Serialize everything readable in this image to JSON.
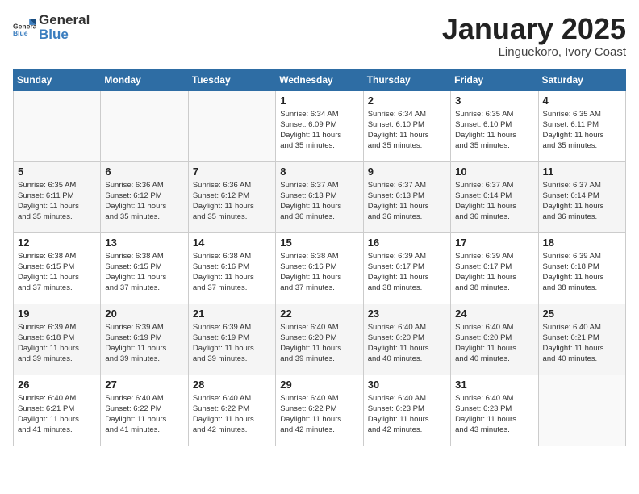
{
  "header": {
    "logo_general": "General",
    "logo_blue": "Blue",
    "month": "January 2025",
    "location": "Linguekoro, Ivory Coast"
  },
  "days_of_week": [
    "Sunday",
    "Monday",
    "Tuesday",
    "Wednesday",
    "Thursday",
    "Friday",
    "Saturday"
  ],
  "weeks": [
    [
      {
        "day": "",
        "info": ""
      },
      {
        "day": "",
        "info": ""
      },
      {
        "day": "",
        "info": ""
      },
      {
        "day": "1",
        "info": "Sunrise: 6:34 AM\nSunset: 6:09 PM\nDaylight: 11 hours\nand 35 minutes."
      },
      {
        "day": "2",
        "info": "Sunrise: 6:34 AM\nSunset: 6:10 PM\nDaylight: 11 hours\nand 35 minutes."
      },
      {
        "day": "3",
        "info": "Sunrise: 6:35 AM\nSunset: 6:10 PM\nDaylight: 11 hours\nand 35 minutes."
      },
      {
        "day": "4",
        "info": "Sunrise: 6:35 AM\nSunset: 6:11 PM\nDaylight: 11 hours\nand 35 minutes."
      }
    ],
    [
      {
        "day": "5",
        "info": "Sunrise: 6:35 AM\nSunset: 6:11 PM\nDaylight: 11 hours\nand 35 minutes."
      },
      {
        "day": "6",
        "info": "Sunrise: 6:36 AM\nSunset: 6:12 PM\nDaylight: 11 hours\nand 35 minutes."
      },
      {
        "day": "7",
        "info": "Sunrise: 6:36 AM\nSunset: 6:12 PM\nDaylight: 11 hours\nand 35 minutes."
      },
      {
        "day": "8",
        "info": "Sunrise: 6:37 AM\nSunset: 6:13 PM\nDaylight: 11 hours\nand 36 minutes."
      },
      {
        "day": "9",
        "info": "Sunrise: 6:37 AM\nSunset: 6:13 PM\nDaylight: 11 hours\nand 36 minutes."
      },
      {
        "day": "10",
        "info": "Sunrise: 6:37 AM\nSunset: 6:14 PM\nDaylight: 11 hours\nand 36 minutes."
      },
      {
        "day": "11",
        "info": "Sunrise: 6:37 AM\nSunset: 6:14 PM\nDaylight: 11 hours\nand 36 minutes."
      }
    ],
    [
      {
        "day": "12",
        "info": "Sunrise: 6:38 AM\nSunset: 6:15 PM\nDaylight: 11 hours\nand 37 minutes."
      },
      {
        "day": "13",
        "info": "Sunrise: 6:38 AM\nSunset: 6:15 PM\nDaylight: 11 hours\nand 37 minutes."
      },
      {
        "day": "14",
        "info": "Sunrise: 6:38 AM\nSunset: 6:16 PM\nDaylight: 11 hours\nand 37 minutes."
      },
      {
        "day": "15",
        "info": "Sunrise: 6:38 AM\nSunset: 6:16 PM\nDaylight: 11 hours\nand 37 minutes."
      },
      {
        "day": "16",
        "info": "Sunrise: 6:39 AM\nSunset: 6:17 PM\nDaylight: 11 hours\nand 38 minutes."
      },
      {
        "day": "17",
        "info": "Sunrise: 6:39 AM\nSunset: 6:17 PM\nDaylight: 11 hours\nand 38 minutes."
      },
      {
        "day": "18",
        "info": "Sunrise: 6:39 AM\nSunset: 6:18 PM\nDaylight: 11 hours\nand 38 minutes."
      }
    ],
    [
      {
        "day": "19",
        "info": "Sunrise: 6:39 AM\nSunset: 6:18 PM\nDaylight: 11 hours\nand 39 minutes."
      },
      {
        "day": "20",
        "info": "Sunrise: 6:39 AM\nSunset: 6:19 PM\nDaylight: 11 hours\nand 39 minutes."
      },
      {
        "day": "21",
        "info": "Sunrise: 6:39 AM\nSunset: 6:19 PM\nDaylight: 11 hours\nand 39 minutes."
      },
      {
        "day": "22",
        "info": "Sunrise: 6:40 AM\nSunset: 6:20 PM\nDaylight: 11 hours\nand 39 minutes."
      },
      {
        "day": "23",
        "info": "Sunrise: 6:40 AM\nSunset: 6:20 PM\nDaylight: 11 hours\nand 40 minutes."
      },
      {
        "day": "24",
        "info": "Sunrise: 6:40 AM\nSunset: 6:20 PM\nDaylight: 11 hours\nand 40 minutes."
      },
      {
        "day": "25",
        "info": "Sunrise: 6:40 AM\nSunset: 6:21 PM\nDaylight: 11 hours\nand 40 minutes."
      }
    ],
    [
      {
        "day": "26",
        "info": "Sunrise: 6:40 AM\nSunset: 6:21 PM\nDaylight: 11 hours\nand 41 minutes."
      },
      {
        "day": "27",
        "info": "Sunrise: 6:40 AM\nSunset: 6:22 PM\nDaylight: 11 hours\nand 41 minutes."
      },
      {
        "day": "28",
        "info": "Sunrise: 6:40 AM\nSunset: 6:22 PM\nDaylight: 11 hours\nand 42 minutes."
      },
      {
        "day": "29",
        "info": "Sunrise: 6:40 AM\nSunset: 6:22 PM\nDaylight: 11 hours\nand 42 minutes."
      },
      {
        "day": "30",
        "info": "Sunrise: 6:40 AM\nSunset: 6:23 PM\nDaylight: 11 hours\nand 42 minutes."
      },
      {
        "day": "31",
        "info": "Sunrise: 6:40 AM\nSunset: 6:23 PM\nDaylight: 11 hours\nand 43 minutes."
      },
      {
        "day": "",
        "info": ""
      }
    ]
  ]
}
